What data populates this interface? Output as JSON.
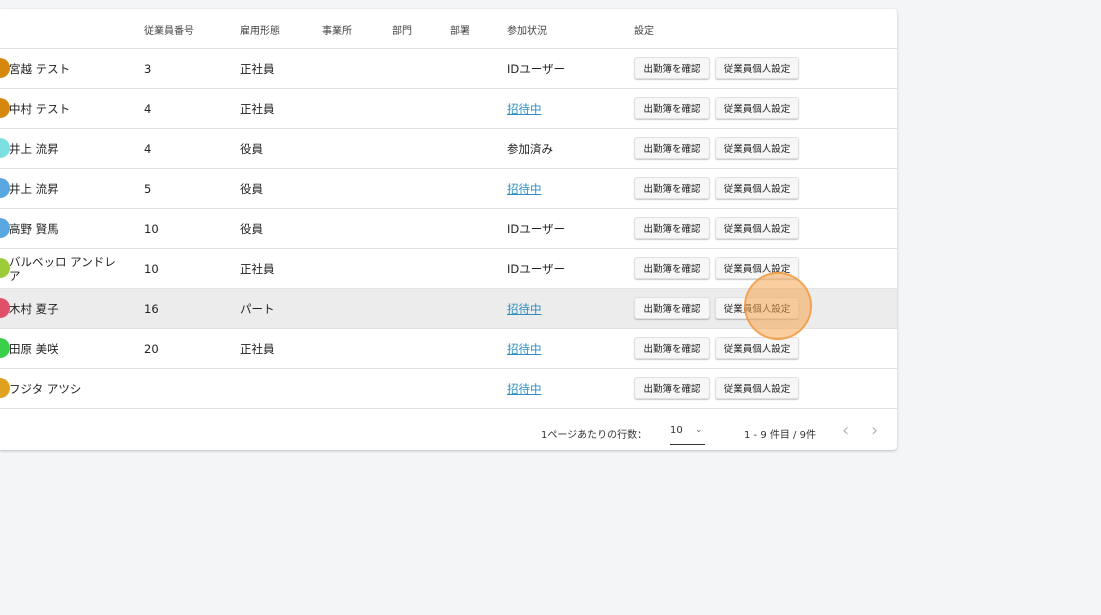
{
  "table": {
    "headers": {
      "emp_no": "従業員番号",
      "emp_type": "雇用形態",
      "office": "事業所",
      "dept": "部門",
      "section": "部署",
      "status": "参加状況",
      "settings": "設定"
    },
    "buttons": {
      "attendance": "出勤簿を確認",
      "personal": "従業員個人設定"
    },
    "rows": [
      {
        "name": "宮越 テスト",
        "emp_no": "3",
        "emp_type": "正社員",
        "status": "IDユーザー",
        "avatar_color": "#d4880e"
      },
      {
        "name": "中村 テスト",
        "emp_no": "4",
        "emp_type": "正社員",
        "status": "招待中",
        "avatar_color": "#d4880e"
      },
      {
        "name": "井上 流昇",
        "emp_no": "4",
        "emp_type": "役員",
        "status": "参加済み",
        "avatar_color": "#7de0e0"
      },
      {
        "name": "井上 流昇",
        "emp_no": "5",
        "emp_type": "役員",
        "status": "招待中",
        "avatar_color": "#5aa7e0"
      },
      {
        "name": "高野 賢馬",
        "emp_no": "10",
        "emp_type": "役員",
        "status": "IDユーザー",
        "avatar_color": "#5aa7e0"
      },
      {
        "name": "バルベッロ アンドレア",
        "emp_no": "10",
        "emp_type": "正社員",
        "status": "IDユーザー",
        "avatar_color": "#9ccc3a"
      },
      {
        "name": "木村 夏子",
        "emp_no": "16",
        "emp_type": "パート",
        "status": "招待中",
        "avatar_color": "#e0506a"
      },
      {
        "name": "田原 美咲",
        "emp_no": "20",
        "emp_type": "正社員",
        "status": "招待中",
        "avatar_color": "#3ad04a"
      },
      {
        "name": "フジタ アツシ",
        "emp_no": "",
        "emp_type": "",
        "status": "招待中",
        "avatar_color": "#e0a020"
      }
    ]
  },
  "pagination": {
    "rows_per_page_label": "1ページあたりの行数：",
    "rows_per_page_value": "10",
    "range_text": "1 - 9 件目 / 9件",
    "prev_icon": "chevron-left-icon",
    "next_icon": "chevron-right-icon"
  },
  "colors": {
    "link": "#2a8fbf",
    "hover_row": "#ececec",
    "click_indicator": "#f5a650"
  }
}
